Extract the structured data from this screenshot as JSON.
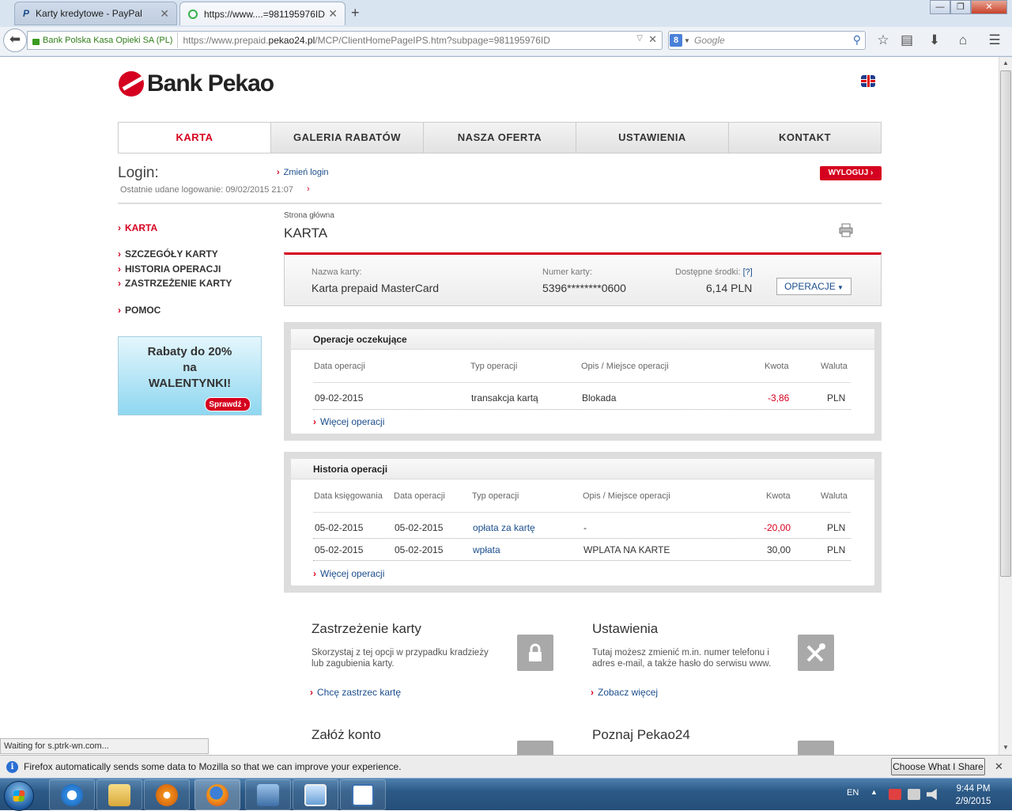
{
  "browser": {
    "tabs": [
      {
        "title": "Karty kredytowe - PayPal",
        "active": false
      },
      {
        "title": "https://www....=981195976ID",
        "active": true
      }
    ],
    "new_tab": "+",
    "window_controls": {
      "minimize": "—",
      "restore": "❐",
      "close": "✕"
    },
    "site_identity": "Bank Polska Kasa Opieki SA (PL)",
    "url_prefix": "https://www.prepaid.",
    "url_domain": "pekao24.pl",
    "url_path": "/MCP/ClientHomePageIPS.htm?subpage=981195976ID",
    "search_placeholder": "Google",
    "status_text": "Waiting for s.ptrk-wn.com...",
    "notification_text": "Firefox automatically sends some data to Mozilla so that we can improve your experience.",
    "notification_button": "Choose What I Share"
  },
  "site": {
    "logo_text": "Bank Pekao",
    "nav": [
      "KARTA",
      "GALERIA RABATÓW",
      "NASZA OFERTA",
      "USTAWIENIA",
      "KONTAKT"
    ],
    "login_label": "Login:",
    "last_login": "Ostatnie udane logowanie: 09/02/2015 21:07",
    "change_login": "Zmień login",
    "logout": "WYLOGUJ",
    "sidebar": {
      "active": "KARTA",
      "items": [
        "SZCZEGÓŁY KARTY",
        "HISTORIA OPERACJI",
        "ZASTRZEŻENIE KARTY"
      ],
      "help": "POMOC"
    },
    "promo": {
      "line1": "Rabaty do 20%",
      "line2": "na",
      "line3": "WALENTYNKI!",
      "button": "Sprawdź"
    },
    "breadcrumb": "Strona główna",
    "page_title": "KARTA",
    "card": {
      "name_label": "Nazwa karty:",
      "name": "Karta prepaid MasterCard",
      "number_label": "Numer karty:",
      "number": "5396********0600",
      "funds_label": "Dostępne środki:",
      "funds_help": "[?]",
      "funds": "6,14 PLN",
      "ops_button": "OPERACJE"
    },
    "pending": {
      "title": "Operacje oczekujące",
      "headers": [
        "Data operacji",
        "Typ operacji",
        "Opis / Miejsce operacji",
        "Kwota",
        "Waluta"
      ],
      "rows": [
        {
          "date": "09-02-2015",
          "type": "transakcja kartą",
          "desc": "Blokada",
          "amount": "-3,86",
          "currency": "PLN"
        }
      ],
      "more": "Więcej operacji"
    },
    "history": {
      "title": "Historia operacji",
      "headers": [
        "Data księgowania",
        "Data operacji",
        "Typ operacji",
        "Opis / Miejsce operacji",
        "Kwota",
        "Waluta"
      ],
      "rows": [
        {
          "booking": "05-02-2015",
          "date": "05-02-2015",
          "type": "opłata za kartę",
          "desc": "-",
          "amount": "-20,00",
          "currency": "PLN"
        },
        {
          "booking": "05-02-2015",
          "date": "05-02-2015",
          "type": "wpłata",
          "desc": "WPLATA NA KARTE",
          "amount": "30,00",
          "currency": "PLN"
        }
      ],
      "more": "Więcej operacji"
    },
    "promos": [
      {
        "title": "Zastrzeżenie karty",
        "desc": "Skorzystaj z tej opcji w przypadku kradzieży lub zagubienia karty.",
        "link": "Chcę zastrzec kartę"
      },
      {
        "title": "Ustawienia",
        "desc": "Tutaj możesz zmienić m.in. numer telefonu i adres e-mail, a także hasło do serwisu www.",
        "link": "Zobacz więcej"
      },
      {
        "title": "Załóż konto"
      },
      {
        "title": "Poznaj Pekao24"
      }
    ]
  },
  "taskbar": {
    "lang": "EN",
    "time": "9:44 PM",
    "date": "2/9/2015"
  },
  "colors": {
    "brand_red": "#d5001f",
    "link_blue": "#1b4d8c"
  }
}
